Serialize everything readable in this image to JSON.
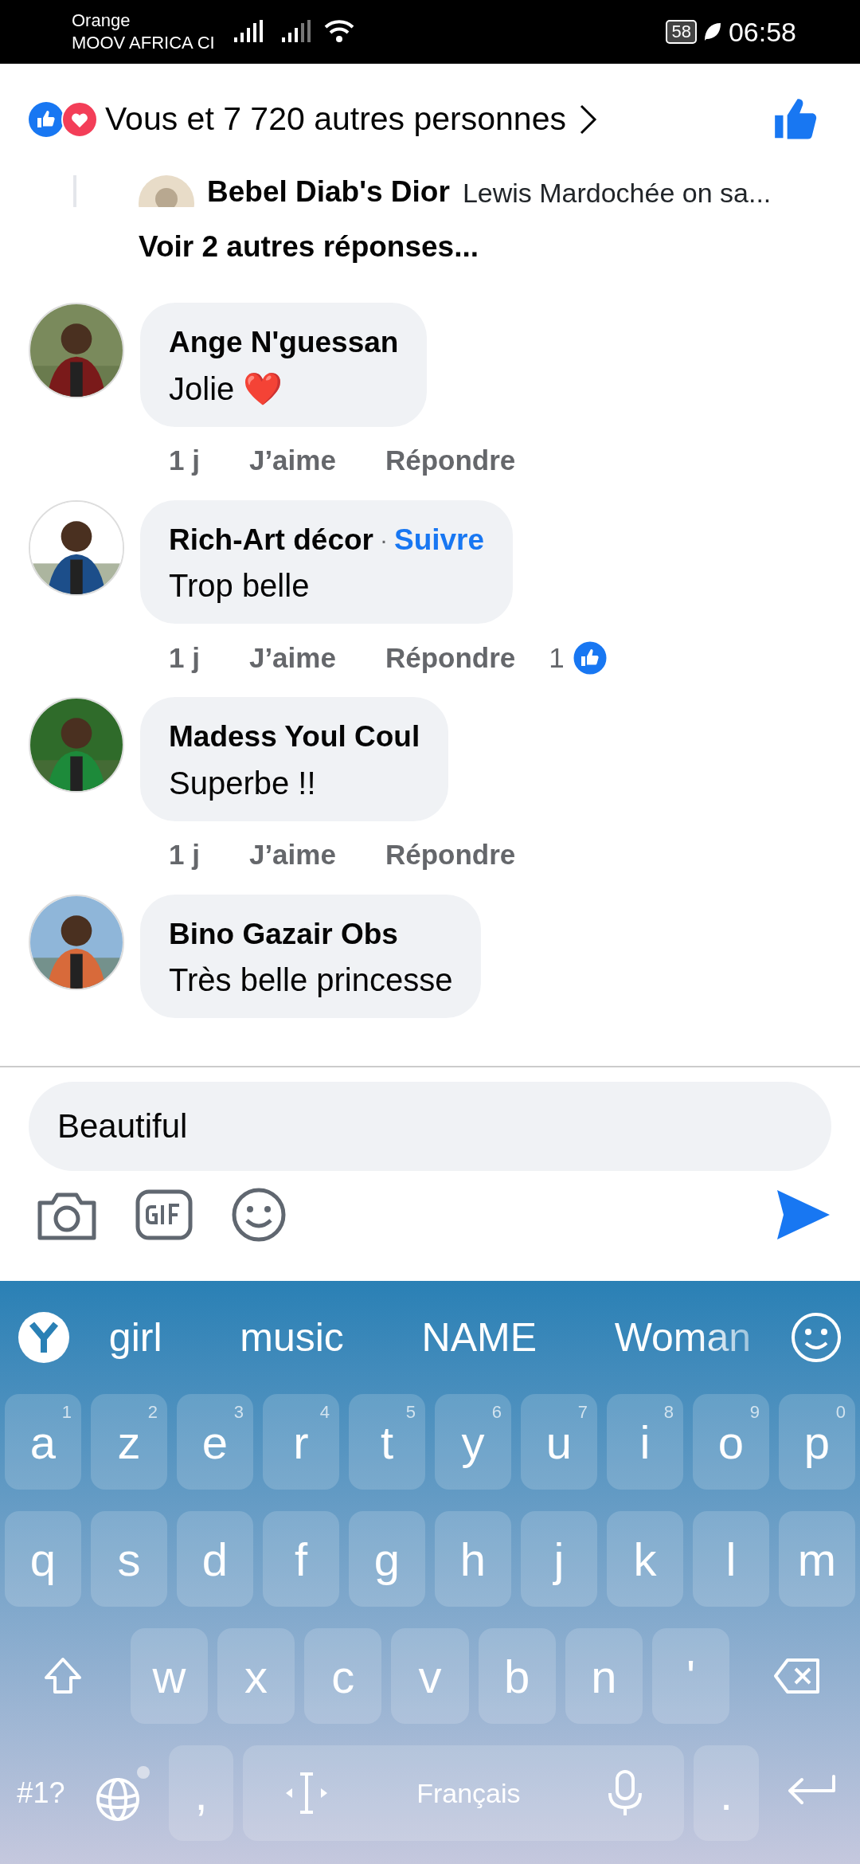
{
  "status_bar": {
    "carrier_1": "Orange",
    "carrier_2": "MOOV AFRICA CI",
    "battery": "58",
    "time": "06:58"
  },
  "reactions_bar": {
    "text": "Vous et 7 720 autres personnes",
    "liked": true
  },
  "partial_reply": {
    "author": "Bebel Diab's Dior",
    "text": "Lewis Mardochée on sa..."
  },
  "more_replies": "Voir 2 autres réponses...",
  "comments": [
    {
      "author": "Ange N'guessan",
      "text": "Jolie ❤️",
      "time": "1 j",
      "like": "J’aime",
      "reply": "Répondre"
    },
    {
      "author": "Rich-Art décor",
      "separator": "·",
      "follow": "Suivre",
      "text": "Trop belle",
      "time": "1 j",
      "like": "J’aime",
      "reply": "Répondre",
      "like_count": "1"
    },
    {
      "author": "Madess Youl Coul",
      "text": "Superbe !!",
      "time": "1 j",
      "like": "J’aime",
      "reply": "Répondre"
    },
    {
      "author": "Bino Gazair Obs",
      "text": "Très belle princesse"
    }
  ],
  "composer": {
    "value": "Beautiful"
  },
  "keyboard": {
    "suggestions": [
      "girl",
      "music",
      "NAME",
      "Woman"
    ],
    "row_1": [
      {
        "key": "a",
        "hint": "1"
      },
      {
        "key": "z",
        "hint": "2"
      },
      {
        "key": "e",
        "hint": "3"
      },
      {
        "key": "r",
        "hint": "4"
      },
      {
        "key": "t",
        "hint": "5"
      },
      {
        "key": "y",
        "hint": "6"
      },
      {
        "key": "u",
        "hint": "7"
      },
      {
        "key": "i",
        "hint": "8"
      },
      {
        "key": "o",
        "hint": "9"
      },
      {
        "key": "p",
        "hint": "0"
      }
    ],
    "row_2": [
      "q",
      "s",
      "d",
      "f",
      "g",
      "h",
      "j",
      "k",
      "l",
      "m"
    ],
    "row_3": [
      "w",
      "x",
      "c",
      "v",
      "b",
      "n",
      "'"
    ],
    "symbols_key": "#1?",
    "comma_key": ",",
    "space_key": "Français",
    "period_key": "."
  }
}
